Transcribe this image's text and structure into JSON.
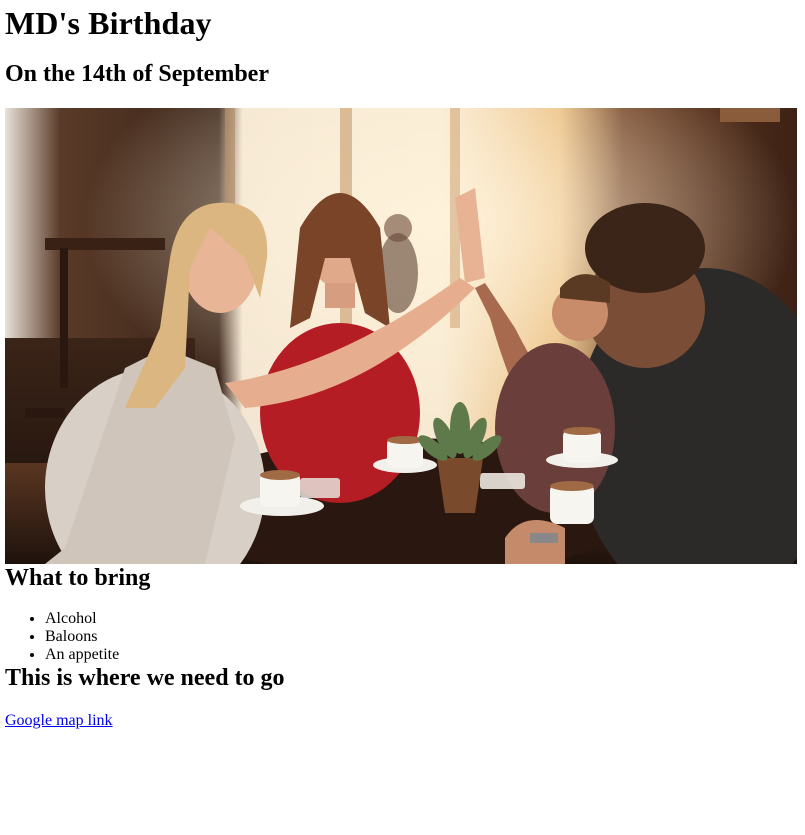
{
  "header": {
    "title": "MD's Birthday",
    "subtitle": "On the 14th of September"
  },
  "hero": {
    "description_icon": "photo-friends-high-five-cafe"
  },
  "bring": {
    "heading": "What to bring",
    "items": [
      "Alcohol",
      "Baloons",
      "An appetite"
    ]
  },
  "location": {
    "heading": "This is where we need to go",
    "link_label": "Google map link"
  },
  "colors": {
    "link": "#0000ee",
    "text": "#000000",
    "background": "#ffffff"
  }
}
